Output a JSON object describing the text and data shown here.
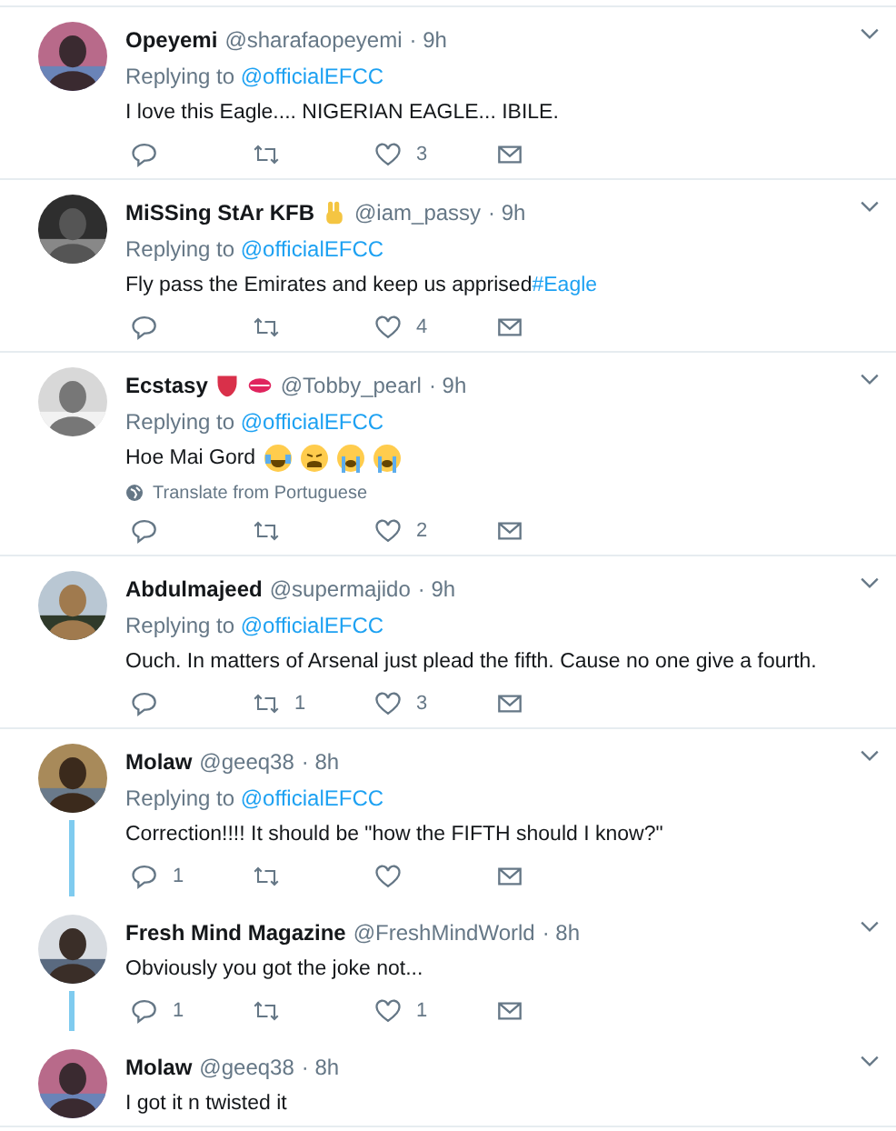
{
  "tweets": [
    {
      "avatar": {
        "kind": "picture"
      },
      "name": "Opeyemi",
      "handle": "@sharafaopeyemi",
      "time": "· 9h",
      "replying_label": "Replying to",
      "replying_to": "@officialEFCC",
      "text": "I love this Eagle.... NIGERIAN EAGLE... IBILE.",
      "actions": {
        "likes": "3"
      },
      "thread_below": false
    },
    {
      "avatar": {
        "kind": "picture"
      },
      "name": "MiSSing StAr KFB",
      "name_icons": [
        {
          "kind": "peace"
        }
      ],
      "handle": "@iam_passy",
      "time": "· 9h",
      "replying_label": "Replying to",
      "replying_to": "@officialEFCC",
      "text": "Fly pass the Emirates and keep us apprised",
      "hashtag": "#Eagle",
      "actions": {
        "likes": "4"
      },
      "thread_below": false
    },
    {
      "avatar": {
        "kind": "picture"
      },
      "name": "Ecstasy",
      "name_icons": [
        {
          "kind": "tongue"
        },
        {
          "kind": "lips"
        }
      ],
      "handle": "@Tobby_pearl",
      "time": "· 9h",
      "replying_label": "Replying to",
      "replying_to": "@officialEFCC",
      "text": "Hoe Mai Gord",
      "emojis": [
        {
          "kind": "joy"
        },
        {
          "kind": "weary"
        },
        {
          "kind": "sob"
        },
        {
          "kind": "sob"
        }
      ],
      "translate": "Translate from Portuguese",
      "actions": {
        "likes": "2"
      },
      "thread_below": false
    },
    {
      "avatar": {
        "kind": "picture"
      },
      "name": "Abdulmajeed",
      "handle": "@supermajido",
      "time": "· 9h",
      "replying_label": "Replying to",
      "replying_to": "@officialEFCC",
      "text": "Ouch. In matters of Arsenal just plead the fifth. Cause no one give a fourth.",
      "actions": {
        "retweets": "1",
        "likes": "3"
      },
      "thread_below": false
    },
    {
      "avatar": {
        "kind": "picture"
      },
      "name": "Molaw",
      "handle": "@geeq38",
      "time": "· 8h",
      "replying_label": "Replying to",
      "replying_to": "@officialEFCC",
      "text": "Correction!!!! It should be \"how the FIFTH should I know?\"",
      "actions": {
        "replies": "1"
      },
      "thread_below": true
    },
    {
      "avatar": {
        "kind": "picture"
      },
      "name": "Fresh Mind Magazine",
      "handle": "@FreshMindWorld",
      "time": "· 8h",
      "text": "Obviously you got the joke not...",
      "actions": {
        "replies": "1",
        "likes": "1"
      },
      "thread_below": true
    },
    {
      "avatar": {
        "kind": "picture"
      },
      "name": "Molaw",
      "handle": "@geeq38",
      "time": "· 8h",
      "text": "I got it n twisted it",
      "thread_below": false
    }
  ]
}
